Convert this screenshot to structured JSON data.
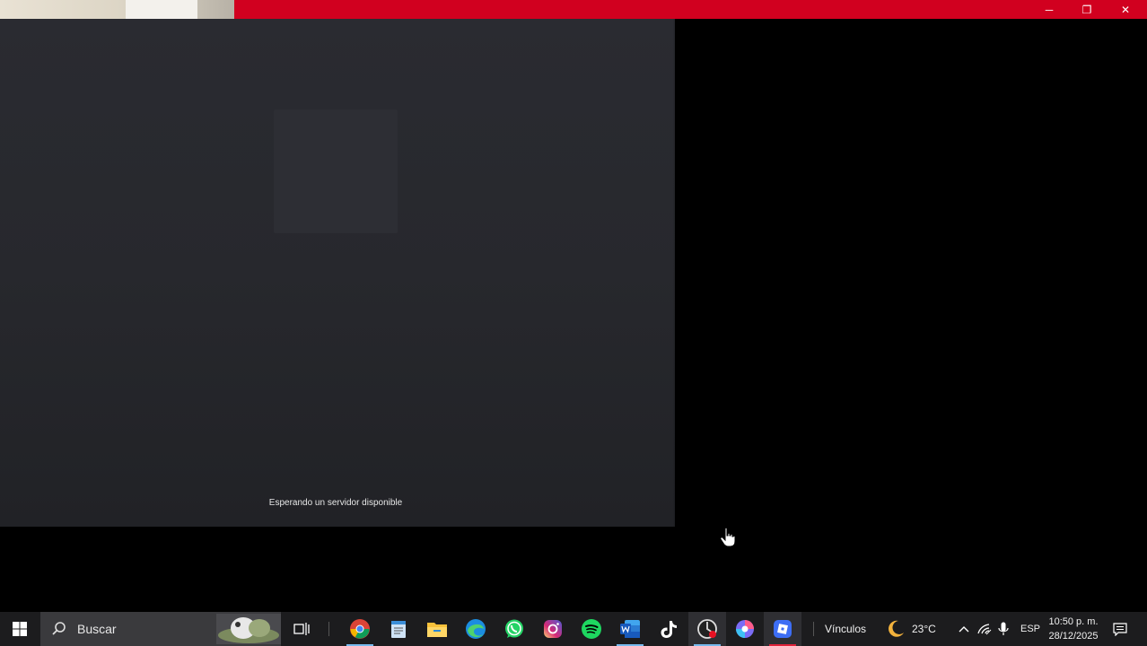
{
  "app": {
    "status_text": "Esperando un servidor disponible",
    "titlebar_color": "#d1001f",
    "window_controls": {
      "minimize": "─",
      "maximize": "❐",
      "close": "✕"
    }
  },
  "taskbar": {
    "search_placeholder": "Buscar",
    "pinned": [
      {
        "name": "task-view-icon"
      },
      {
        "name": "chrome-icon"
      },
      {
        "name": "notepad-icon"
      },
      {
        "name": "file-explorer-icon"
      },
      {
        "name": "edge-icon"
      },
      {
        "name": "whatsapp-icon"
      },
      {
        "name": "instagram-icon"
      },
      {
        "name": "spotify-icon"
      },
      {
        "name": "word-icon"
      },
      {
        "name": "tiktok-icon"
      },
      {
        "name": "recorder-icon"
      },
      {
        "name": "browser-icon"
      },
      {
        "name": "roblox-icon"
      }
    ],
    "links_label": "Vínculos",
    "weather_temp": "23°C",
    "language": "ESP",
    "time": "10:50 p. m.",
    "date": "28/12/2025"
  }
}
